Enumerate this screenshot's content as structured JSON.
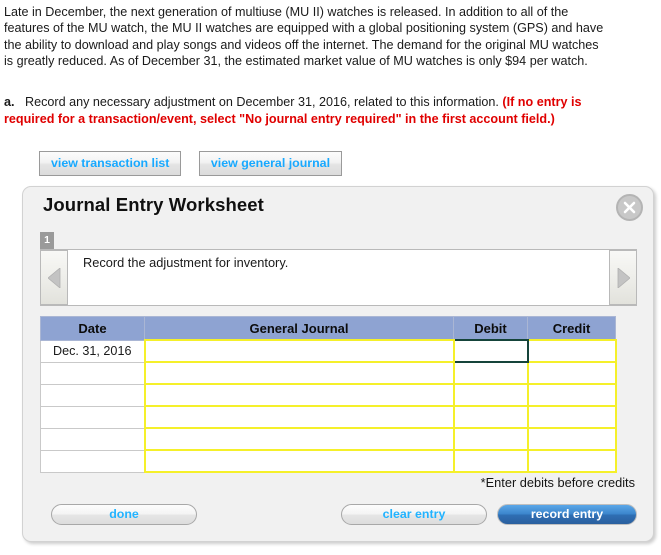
{
  "intro": {
    "paragraph": "Late in December, the next generation of multiuse (MU II) watches is released. In addition to all of the features of the MU watch, the MU II watches are equipped with a global positioning system (GPS) and have the ability to download and play songs and videos off the internet. The demand for the original MU watches is greatly reduced. As of December 31, the estimated market value of MU watches is only $94 per watch."
  },
  "question": {
    "letter": "a.",
    "text": "Record any necessary adjustment on December 31, 2016, related to this information.",
    "red_note": "(If no entry is required for a transaction/event, select \"No journal entry required\" in the first account field.)"
  },
  "view_buttons": [
    {
      "label": "view transaction list",
      "name": "view-transaction-list-button"
    },
    {
      "label": "view general journal",
      "name": "view-general-journal-button"
    }
  ],
  "worksheet": {
    "title": "Journal Entry Worksheet",
    "close_label": "X",
    "tab_number": "1",
    "prompt": "Record the adjustment for inventory.",
    "prev_arrow": "prev-entry-arrow",
    "next_arrow": "next-entry-arrow",
    "note": "*Enter debits before credits",
    "table": {
      "headers": [
        "Date",
        "General Journal",
        "Debit",
        "Credit"
      ],
      "rows": [
        {
          "date": "Dec. 31, 2016",
          "general_journal": "",
          "debit": "",
          "credit": ""
        },
        {
          "date": "",
          "general_journal": "",
          "debit": "",
          "credit": ""
        },
        {
          "date": "",
          "general_journal": "",
          "debit": "",
          "credit": ""
        },
        {
          "date": "",
          "general_journal": "",
          "debit": "",
          "credit": ""
        },
        {
          "date": "",
          "general_journal": "",
          "debit": "",
          "credit": ""
        },
        {
          "date": "",
          "general_journal": "",
          "debit": "",
          "credit": ""
        }
      ]
    },
    "footer_buttons": {
      "done": "done",
      "clear_entry": "clear entry",
      "record_entry": "record entry"
    }
  },
  "colors": {
    "table_header_blue": "#8ea3d2",
    "editable_cell_yellow": "#f5f02a",
    "focused_cell_border": "#15443a",
    "link_blue": "#18a9ff",
    "record_button_blue": "#3b85cc",
    "warning_red": "#e00000"
  }
}
